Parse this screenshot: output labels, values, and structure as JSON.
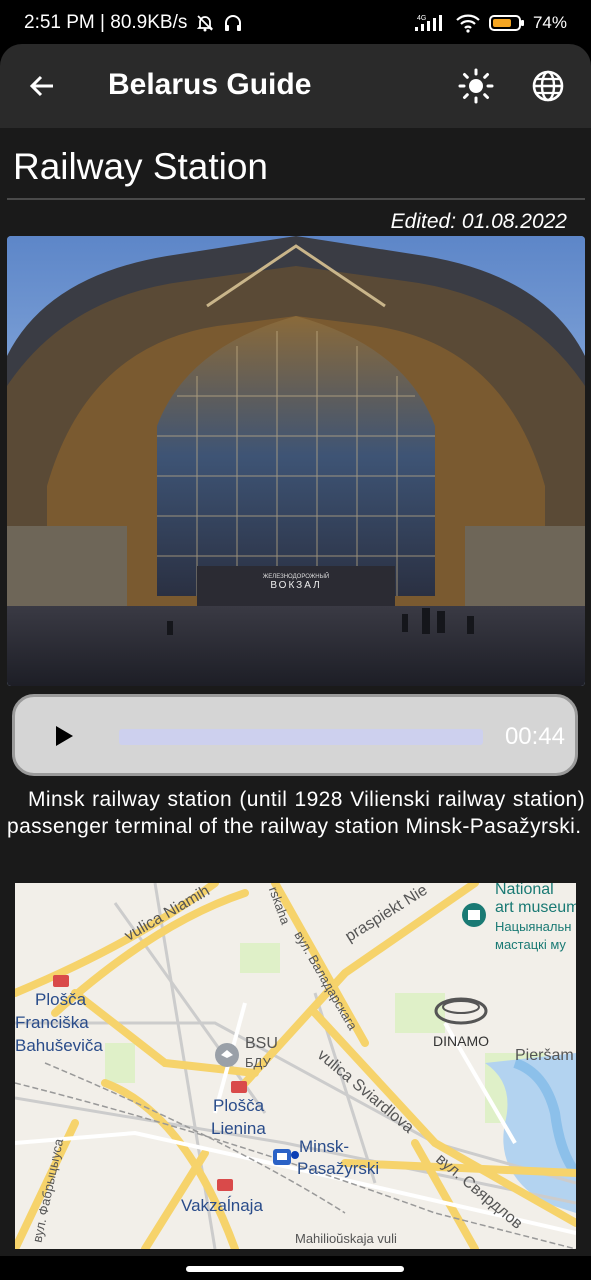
{
  "status_bar": {
    "time_speed": "2:51 PM | 80.9KB/s",
    "network": "4G",
    "battery": "74%"
  },
  "app_bar": {
    "title": "Belarus Guide"
  },
  "page": {
    "title": "Railway Station",
    "edited": "Edited: 01.08.2022"
  },
  "photo": {
    "sign_small": "ЖЕЛЕЗНОДОРОЖНЫЙ",
    "sign_big": "ВОКЗАЛ"
  },
  "player": {
    "time": "00:44",
    "progress": 0
  },
  "description": "Minsk railway station (until 1928  Vilienski railway station)  passenger terminal of the railway station Minsk-Pasažyrski.",
  "map": {
    "labels": {
      "niamih": "vulica Niamih",
      "praspiekt": "praspiekt Nie",
      "rskaha": "rskaha",
      "valadarskaha": "вул. Валадарскага",
      "national_1": "National",
      "national_2": "art museum",
      "national_ru1": "Нацыянальн",
      "national_ru2": "мастацкі му",
      "plosca_fr1": "Plošča",
      "plosca_fr2": "Franciška",
      "plosca_fr3": "Bahuševiča",
      "bsu": "BSU",
      "bsu_ru": "БДУ",
      "dinamo": "DINAMO",
      "piersam": "Pieršam",
      "sviardlova": "vulica Sviardlova",
      "plosca_l1": "Plošča",
      "plosca_l2": "Lienina",
      "minsk_p1": "Minsk-",
      "minsk_p2": "Pasažyrski",
      "sviardlova_ru": "вул. Свярдлов",
      "fabrycyusa": "вул. Фабрыцыуса",
      "vakzalnaja": "Vakzaĺnaja",
      "mahiliouskaja": "Mahilioŭskaja vuli"
    }
  }
}
